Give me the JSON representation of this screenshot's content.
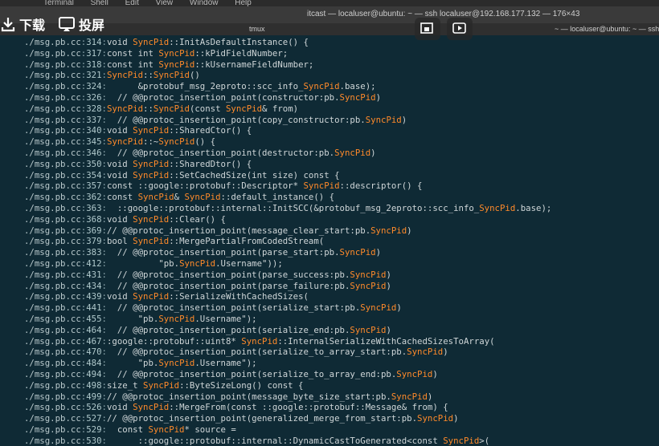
{
  "menubar": {
    "items": [
      "Terminal",
      "Shell",
      "Edit",
      "View",
      "Window",
      "Help"
    ]
  },
  "window": {
    "title": "itcast — localuser@ubuntu: ~ — ssh localuser@192.168.177.132 — 176×43"
  },
  "tmux": {
    "tab_label": "tmux",
    "right_label": "~ — localuser@ubuntu: ~ — ssh l"
  },
  "overlay": {
    "download_label": "下载",
    "project_label": "投屏",
    "icons": [
      "download-icon",
      "screen-cast-icon",
      "pip-icon",
      "play-screen-icon"
    ]
  },
  "colors": {
    "background": "#0f2a35",
    "text": "#cfd6d8",
    "highlight": "#ff8a2a"
  },
  "terminal": {
    "file": "./msg.pb.cc",
    "lines": [
      {
        "num": "314",
        "code": "void SyncPid::InitAsDefaultInstance() {"
      },
      {
        "num": "317",
        "code": "const int SyncPid::kPidFieldNumber;"
      },
      {
        "num": "318",
        "code": "const int SyncPid::kUsernameFieldNumber;"
      },
      {
        "num": "321",
        "code": "SyncPid::SyncPid()"
      },
      {
        "num": "324",
        "code": "      &protobuf_msg_2eproto::scc_info_SyncPid.base);"
      },
      {
        "num": "326",
        "code": "  // @@protoc_insertion_point(constructor:pb.SyncPid)"
      },
      {
        "num": "328",
        "code": "SyncPid::SyncPid(const SyncPid& from)"
      },
      {
        "num": "337",
        "code": "  // @@protoc_insertion_point(copy_constructor:pb.SyncPid)"
      },
      {
        "num": "340",
        "code": "void SyncPid::SharedCtor() {"
      },
      {
        "num": "345",
        "code": "SyncPid::~SyncPid() {"
      },
      {
        "num": "346",
        "code": "  // @@protoc_insertion_point(destructor:pb.SyncPid)"
      },
      {
        "num": "350",
        "code": "void SyncPid::SharedDtor() {"
      },
      {
        "num": "354",
        "code": "void SyncPid::SetCachedSize(int size) const {"
      },
      {
        "num": "357",
        "code": "const ::google::protobuf::Descriptor* SyncPid::descriptor() {"
      },
      {
        "num": "362",
        "code": "const SyncPid& SyncPid::default_instance() {"
      },
      {
        "num": "363",
        "code": "  ::google::protobuf::internal::InitSCC(&protobuf_msg_2eproto::scc_info_SyncPid.base);"
      },
      {
        "num": "368",
        "code": "void SyncPid::Clear() {"
      },
      {
        "num": "369",
        "code": "// @@protoc_insertion_point(message_clear_start:pb.SyncPid)"
      },
      {
        "num": "379",
        "code": "bool SyncPid::MergePartialFromCodedStream("
      },
      {
        "num": "383",
        "code": "  // @@protoc_insertion_point(parse_start:pb.SyncPid)"
      },
      {
        "num": "412",
        "code": "          \"pb.SyncPid.Username\"));"
      },
      {
        "num": "431",
        "code": "  // @@protoc_insertion_point(parse_success:pb.SyncPid)"
      },
      {
        "num": "434",
        "code": "  // @@protoc_insertion_point(parse_failure:pb.SyncPid)"
      },
      {
        "num": "439",
        "code": "void SyncPid::SerializeWithCachedSizes("
      },
      {
        "num": "441",
        "code": "  // @@protoc_insertion_point(serialize_start:pb.SyncPid)"
      },
      {
        "num": "455",
        "code": "      \"pb.SyncPid.Username\");"
      },
      {
        "num": "464",
        "code": "  // @@protoc_insertion_point(serialize_end:pb.SyncPid)"
      },
      {
        "num": "467",
        "code": ":google::protobuf::uint8* SyncPid::InternalSerializeWithCachedSizesToArray("
      },
      {
        "num": "470",
        "code": "  // @@protoc_insertion_point(serialize_to_array_start:pb.SyncPid)"
      },
      {
        "num": "484",
        "code": "      \"pb.SyncPid.Username\");"
      },
      {
        "num": "494",
        "code": "  // @@protoc_insertion_point(serialize_to_array_end:pb.SyncPid)"
      },
      {
        "num": "498",
        "code": "size_t SyncPid::ByteSizeLong() const {"
      },
      {
        "num": "499",
        "code": "// @@protoc_insertion_point(message_byte_size_start:pb.SyncPid)"
      },
      {
        "num": "526",
        "code": "void SyncPid::MergeFrom(const ::google::protobuf::Message& from) {"
      },
      {
        "num": "527",
        "code": "// @@protoc_insertion_point(generalized_merge_from_start:pb.SyncPid)"
      },
      {
        "num": "529",
        "code": "  const SyncPid* source ="
      },
      {
        "num": "530",
        "code": "      ::google::protobuf::internal::DynamicCastToGenerated<const SyncPid>("
      }
    ]
  }
}
